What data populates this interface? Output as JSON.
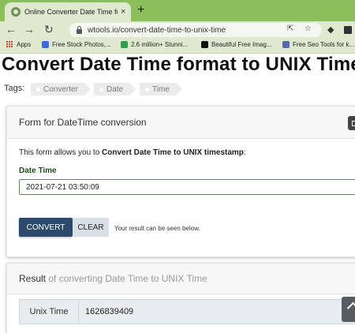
{
  "browser": {
    "tab_title": "Online Converter Date Time form",
    "tab_close": "×",
    "new_tab": "+",
    "url": "wtools.io/convert-date-time-to-unix-time",
    "nav": {
      "back": "←",
      "forward": "→",
      "reload": "↻"
    },
    "bookmarks": [
      {
        "label": "Apps",
        "icon": "apps-grid-icon"
      },
      {
        "label": "Free Stock Photos,...",
        "icon": "image-icon",
        "color": "#3b6fd6"
      },
      {
        "label": "2.6 million+ Stunni...",
        "icon": "px-icon",
        "color": "#2e9e4f"
      },
      {
        "label": "Beautiful Free Imag...",
        "icon": "camera-icon",
        "color": "#111111"
      },
      {
        "label": "Free Seo Tools for k...",
        "icon": "seo-icon",
        "color": "#5a67a8"
      }
    ]
  },
  "page": {
    "title": "Convert Date Time format to UNIX Time",
    "tags_label": "Tags:",
    "tags": [
      "Converter",
      "Date",
      "Time"
    ]
  },
  "form": {
    "card_title": "Form for DateTime conversion",
    "description_prefix": "This form allows you to ",
    "description_bold": "Convert Date Time to UNIX timestamp",
    "description_suffix": ":",
    "field_label": "Date Time",
    "field_value": "2021-07-21 03:50:09",
    "convert_label": "CONVERT",
    "clear_label": "CLEAR",
    "hint": "Your result can be seen below."
  },
  "result": {
    "title_prefix": "Result",
    "title_suffix": " of converting Date Time to UNIX Time",
    "unix_label": "Unix Time",
    "unix_value": "1626839409"
  },
  "colors": {
    "tabbar": "#8bbf5b",
    "toolbar": "#dfe9cf",
    "convert_button": "#2c4a6b",
    "field_label": "#1f4d1f"
  }
}
